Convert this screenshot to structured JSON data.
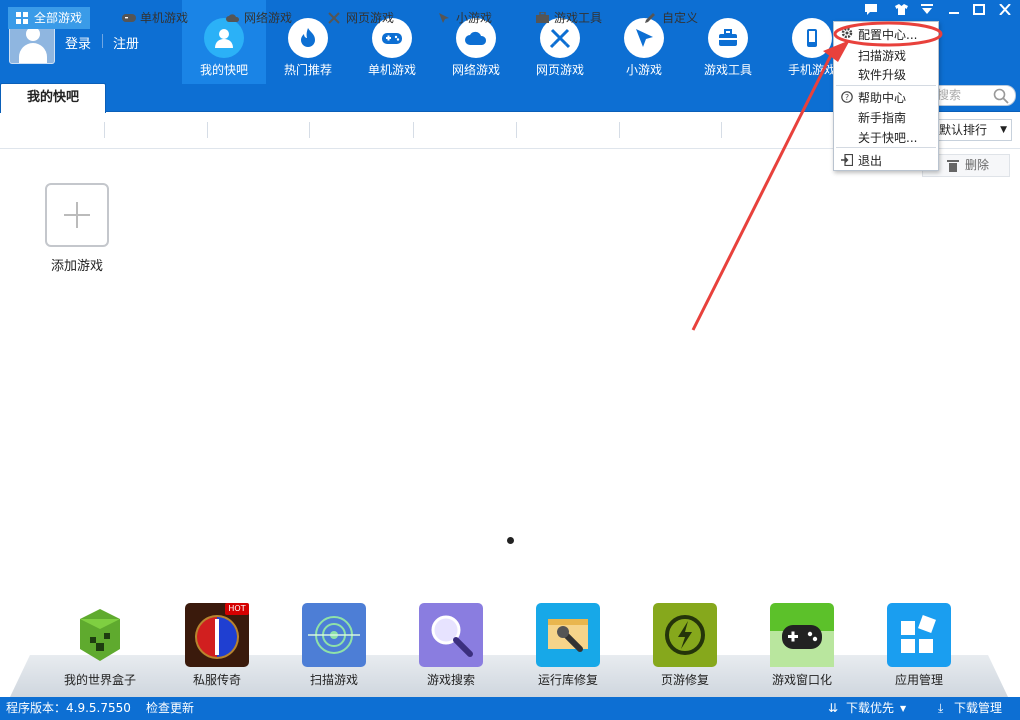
{
  "header": {
    "login": "登录",
    "register": "注册",
    "nav": [
      {
        "label": "我的快吧",
        "icon": "user-icon",
        "active": true
      },
      {
        "label": "热门推荐",
        "icon": "flame-icon"
      },
      {
        "label": "单机游戏",
        "icon": "gamepad-icon"
      },
      {
        "label": "网络游戏",
        "icon": "cloud-icon"
      },
      {
        "label": "网页游戏",
        "icon": "crossed-swords-icon"
      },
      {
        "label": "小游戏",
        "icon": "cursor-icon"
      },
      {
        "label": "游戏工具",
        "icon": "toolbox-icon"
      },
      {
        "label": "手机游戏",
        "icon": "phone-icon"
      }
    ]
  },
  "tabs": {
    "my_tab": "我的快吧"
  },
  "search": {
    "placeholder": "搜索"
  },
  "filters": [
    {
      "label": "全部游戏",
      "icon": "grid-icon",
      "active": true
    },
    {
      "label": "单机游戏",
      "icon": "gamepad-icon"
    },
    {
      "label": "网络游戏",
      "icon": "cloud-icon"
    },
    {
      "label": "网页游戏",
      "icon": "crossed-swords-icon"
    },
    {
      "label": "小游戏",
      "icon": "cursor-icon"
    },
    {
      "label": "游戏工具",
      "icon": "toolbox-icon"
    },
    {
      "label": "自定义",
      "icon": "pencil-icon"
    }
  ],
  "sort": {
    "selected": "默认排行"
  },
  "delete_label": "删除",
  "add_game": "添加游戏",
  "menu": {
    "items": [
      "配置中心...",
      "扫描游戏",
      "软件升级",
      "帮助中心",
      "新手指南",
      "关于快吧...",
      "退出"
    ]
  },
  "apps": [
    {
      "label": "我的世界盒子",
      "icon": "creeper-icon"
    },
    {
      "label": "私服传奇",
      "icon": "legend-icon",
      "badge": "HOT"
    },
    {
      "label": "扫描游戏",
      "icon": "radar-icon"
    },
    {
      "label": "游戏搜索",
      "icon": "magnifier-icon"
    },
    {
      "label": "运行库修复",
      "icon": "wrench-icon"
    },
    {
      "label": "页游修复",
      "icon": "bolt-icon"
    },
    {
      "label": "游戏窗口化",
      "icon": "gamepad-icon"
    },
    {
      "label": "应用管理",
      "icon": "apps-icon"
    }
  ],
  "status": {
    "version": "程序版本：4.9.5.7550",
    "check_update": "检查更新",
    "download_priority": "下载优先",
    "download_manager": "下载管理"
  },
  "colors": {
    "brand": "#0d6fd3",
    "accent": "#3a9be8",
    "annotation": "#e8413c"
  }
}
